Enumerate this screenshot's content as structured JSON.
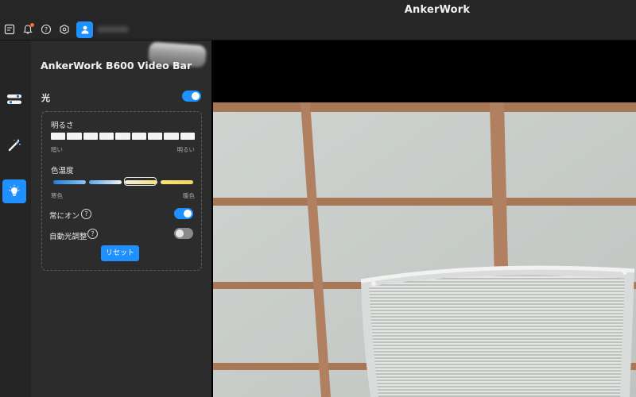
{
  "app": {
    "title": "AnkerWork"
  },
  "topbar": {
    "icons": [
      "feedback-icon",
      "bell-icon",
      "help-icon",
      "settings-hex-icon",
      "user-icon"
    ],
    "notification_dot_color": "#ff6a2a"
  },
  "nav": {
    "items": [
      {
        "name": "controls",
        "icon": "sliders-icon",
        "active": false
      },
      {
        "name": "effects",
        "icon": "magic-wand-icon",
        "active": false
      },
      {
        "name": "light",
        "icon": "lightbulb-icon",
        "active": true
      }
    ]
  },
  "panel": {
    "device_name": "AnkerWork B600 Video Bar",
    "light": {
      "label": "光",
      "enabled": true,
      "brightness": {
        "label": "明るさ",
        "min_label": "暗い",
        "max_label": "明るい",
        "segments": 9,
        "level": 9
      },
      "color_temperature": {
        "label": "色温度",
        "min_label": "寒色",
        "max_label": "暖色",
        "segment_colors": [
          [
            "#1e7fd8",
            "#8fc4f3"
          ],
          [
            "#5aa7ec",
            "#eef2f5"
          ],
          [
            "#f3efe0",
            "#f6e27a"
          ],
          [
            "#f7e47a",
            "#f3d55d"
          ]
        ],
        "selected_index": 2
      },
      "always_on": {
        "label": "常にオン",
        "enabled": true
      },
      "auto_light": {
        "label": "自動光調整",
        "enabled": false
      },
      "reset_label": "リセット"
    }
  },
  "colors": {
    "accent": "#1e90ff",
    "panel_bg": "#2c2c2c"
  }
}
